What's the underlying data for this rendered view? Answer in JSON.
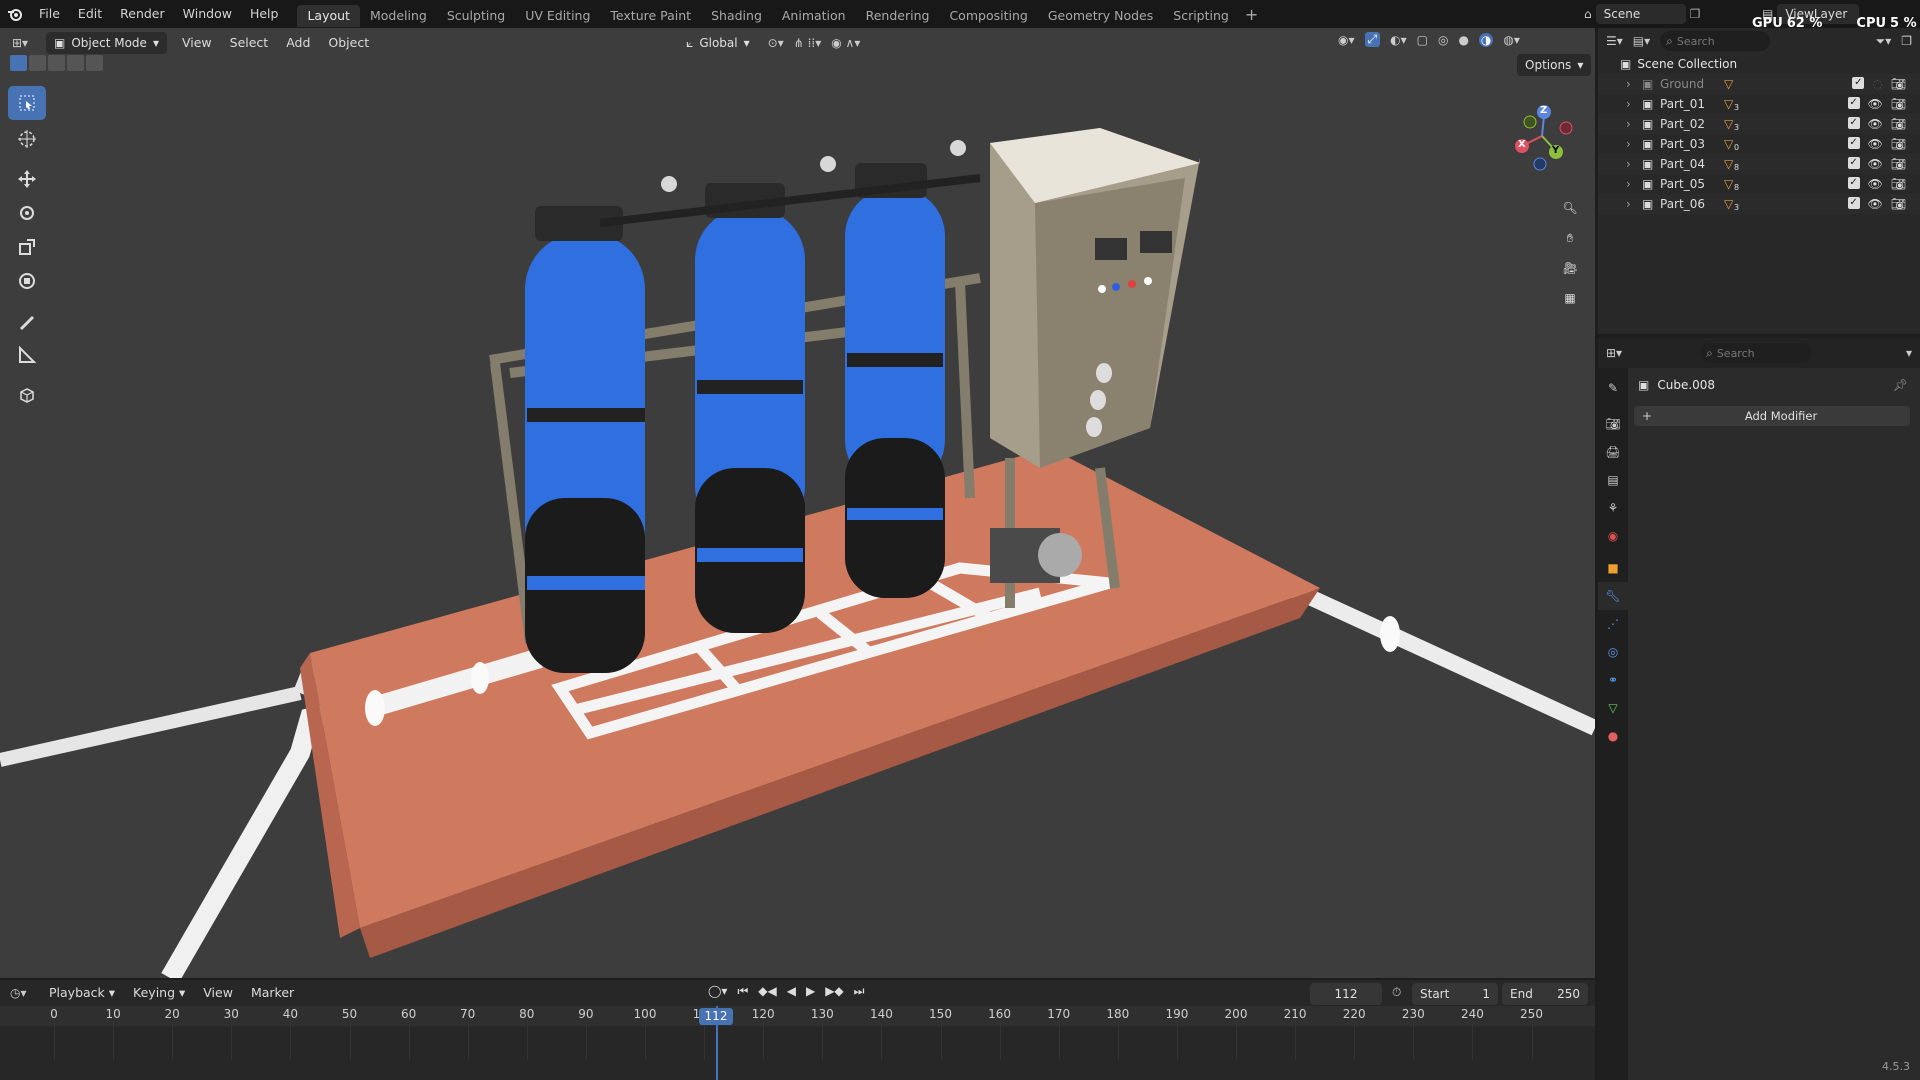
{
  "topbar": {
    "menu": [
      "File",
      "Edit",
      "Render",
      "Window",
      "Help"
    ],
    "workspaces": [
      "Layout",
      "Modeling",
      "Sculpting",
      "UV Editing",
      "Texture Paint",
      "Shading",
      "Animation",
      "Rendering",
      "Compositing",
      "Geometry Nodes",
      "Scripting"
    ],
    "active_workspace": "Layout",
    "scene": "Scene",
    "view_layer": "ViewLayer",
    "gpu_label": "GPU",
    "gpu_value": "62 %",
    "cpu_label": "CPU",
    "cpu_value": "5 %"
  },
  "viewport_header": {
    "mode": "Object Mode",
    "menus": [
      "View",
      "Select",
      "Add",
      "Object"
    ],
    "transform_orientation": "Global",
    "options": "Options"
  },
  "toolbar": {
    "tools": [
      "select-box-icon",
      "cursor-icon",
      "move-icon",
      "rotate-icon",
      "scale-icon",
      "transform-icon",
      "annotate-icon",
      "measure-icon",
      "add-cube-icon"
    ]
  },
  "gizmo": {
    "x": "X",
    "y": "Y",
    "z": "Z"
  },
  "outliner": {
    "search_placeholder": "Search",
    "root": "Scene Collection",
    "items": [
      {
        "name": "Ground",
        "badge": "",
        "dimmed": true
      },
      {
        "name": "Part_01",
        "badge": "3",
        "dimmed": false
      },
      {
        "name": "Part_02",
        "badge": "3",
        "dimmed": false
      },
      {
        "name": "Part_03",
        "badge": "0",
        "dimmed": false
      },
      {
        "name": "Part_04",
        "badge": "8",
        "dimmed": false
      },
      {
        "name": "Part_05",
        "badge": "8",
        "dimmed": false
      },
      {
        "name": "Part_06",
        "badge": "3",
        "dimmed": false
      }
    ]
  },
  "properties": {
    "search_placeholder": "Search",
    "object_name": "Cube.008",
    "add_modifier": "Add Modifier",
    "version": "4.5.3"
  },
  "timeline": {
    "menus": [
      "Playback",
      "Keying",
      "View",
      "Marker"
    ],
    "current_frame": "112",
    "start_label": "Start",
    "start": "1",
    "end_label": "End",
    "end": "250",
    "ticks": [
      "0",
      "10",
      "20",
      "30",
      "40",
      "50",
      "60",
      "70",
      "80",
      "90",
      "100",
      "110",
      "120",
      "130",
      "140",
      "150",
      "160",
      "170",
      "180",
      "190",
      "200",
      "210",
      "220",
      "230",
      "240",
      "250"
    ]
  },
  "colors": {
    "accent": "#4772b3",
    "tank_blue": "#2f6fe0",
    "base": "#c8745a",
    "frame": "#7e7869"
  }
}
